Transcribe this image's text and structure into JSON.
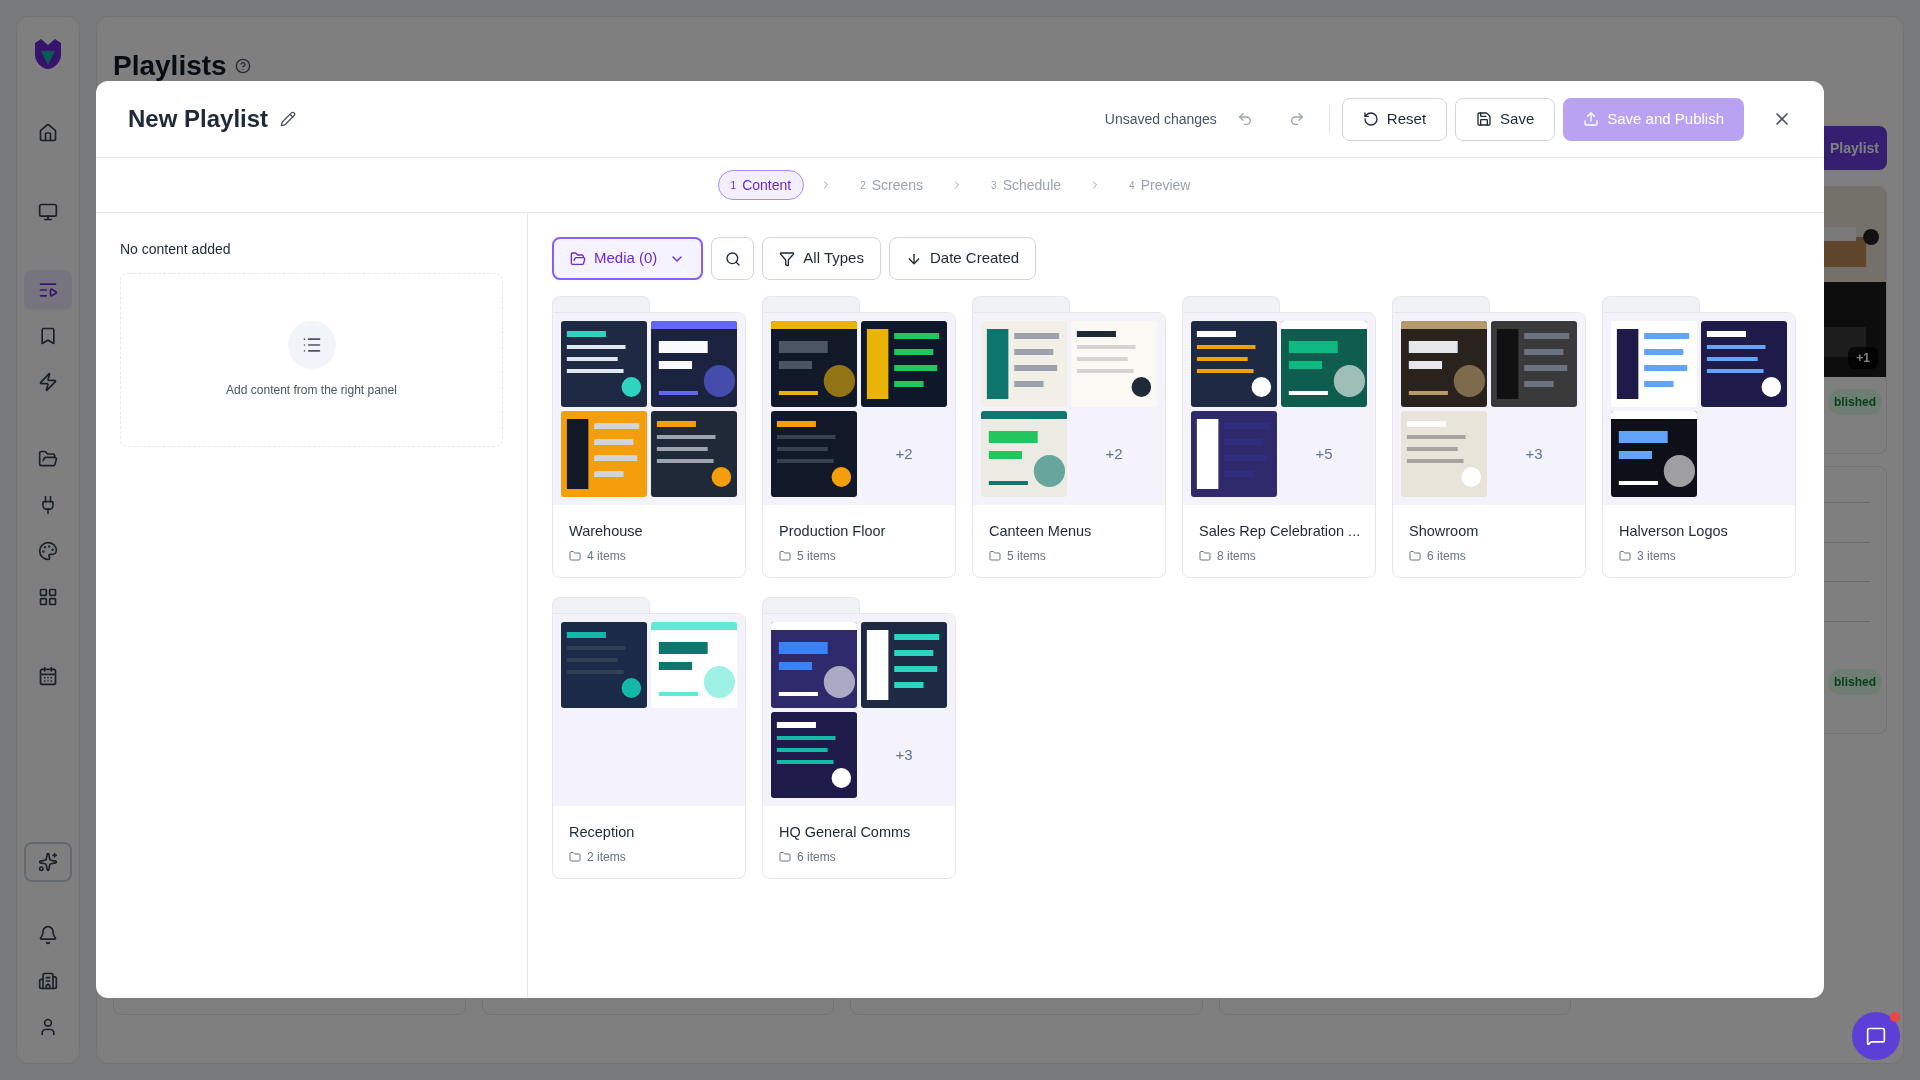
{
  "sidebar": {
    "items": [
      {
        "selected": false
      },
      {
        "selected": false
      },
      {
        "selected": true
      },
      {
        "selected": false
      },
      {
        "selected": false
      },
      {
        "selected": false
      },
      {
        "selected": false
      },
      {
        "selected": false
      },
      {
        "selected": false
      },
      {
        "selected": false
      },
      {
        "selected": false
      },
      {
        "selected": false
      },
      {
        "selected": false
      },
      {
        "selected": false
      }
    ]
  },
  "page": {
    "title": "Playlists",
    "new_button": "Playlist",
    "background_cards": [
      {
        "more": "+1",
        "badge": "blished"
      },
      {
        "badge": "blished"
      }
    ]
  },
  "modal": {
    "title": "New Playlist",
    "status": "Unsaved changes",
    "buttons": {
      "reset": "Reset",
      "save": "Save",
      "publish": {
        "label": "Save and Publish",
        "disabled": true
      }
    },
    "steps": [
      {
        "number": "1",
        "label": "Content",
        "selected": true
      },
      {
        "number": "2",
        "label": "Screens",
        "selected": false
      },
      {
        "number": "3",
        "label": "Schedule",
        "selected": false
      },
      {
        "number": "4",
        "label": "Preview",
        "selected": false
      }
    ],
    "left_panel": {
      "heading": "No content added",
      "empty_hint": "Add content from the right panel"
    },
    "toolbar": {
      "media": "Media (0)",
      "type_filter": "All Types",
      "sort": "Date Created"
    },
    "folders": [
      {
        "name": "Warehouse",
        "count": "4 items"
      },
      {
        "name": "Production Floor",
        "count": "5 items",
        "more": "+2"
      },
      {
        "name": "Canteen Menus",
        "count": "5 items",
        "more": "+2"
      },
      {
        "name": "Sales Rep Celebration ...",
        "count": "8 items",
        "more": "+5"
      },
      {
        "name": "Showroom",
        "count": "6 items",
        "more": "+3"
      },
      {
        "name": "Halverson Logos",
        "count": "3 items"
      },
      {
        "name": "Reception",
        "count": "2 items"
      },
      {
        "name": "HQ General Comms",
        "count": "6 items",
        "more": "+3"
      }
    ]
  }
}
